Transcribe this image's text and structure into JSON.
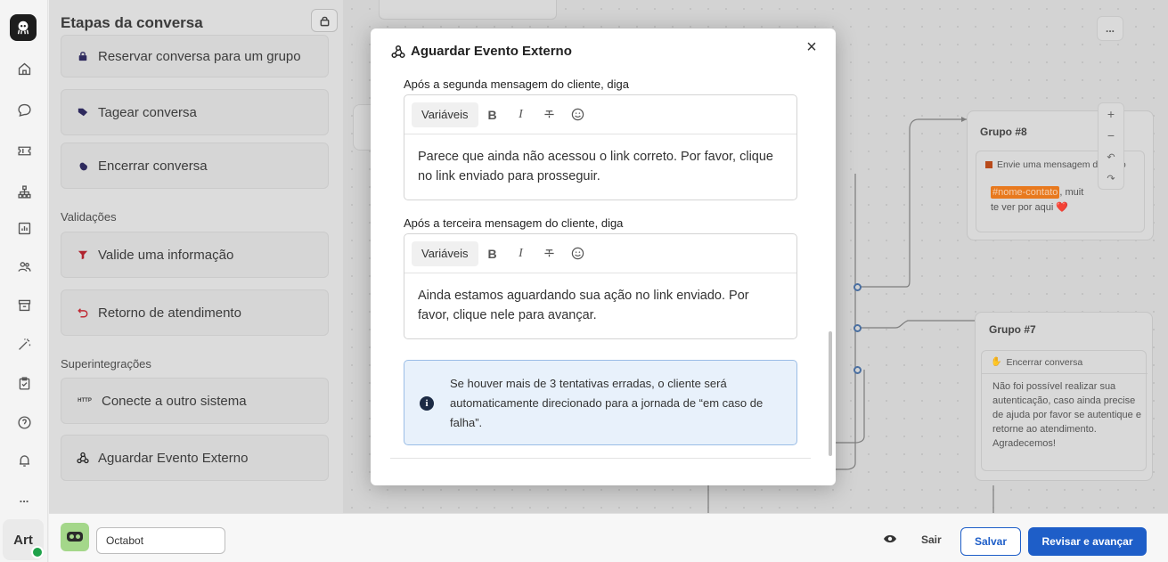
{
  "sidebar": {
    "title": "Etapas da conversa",
    "items_top": [
      {
        "label": "Reservar conversa para um grupo",
        "icon": "lock-icon"
      },
      {
        "label": "Tagear conversa",
        "icon": "tag-icon"
      },
      {
        "label": "Encerrar conversa",
        "icon": "wave-hand-icon"
      }
    ],
    "section_validacoes": "Validações",
    "items_validacoes": [
      {
        "label": "Valide uma informação",
        "icon": "filter-icon"
      },
      {
        "label": "Retorno de atendimento",
        "icon": "return-icon"
      }
    ],
    "section_super": "Superintegrações",
    "items_super": [
      {
        "label": "Conecte a outro sistema",
        "icon": "http-icon"
      },
      {
        "label": "Aguardar Evento Externo",
        "icon": "webhook-icon"
      }
    ]
  },
  "rail": {
    "user_initials": "Art",
    "more": "..."
  },
  "modal": {
    "title": "Aguardar Evento Externo",
    "section1_label": "Após a segunda mensagem do cliente, diga",
    "section1_text": "Parece que ainda não acessou o link correto. Por favor, clique no link enviado para prosseguir.",
    "section2_label": "Após a terceira mensagem do cliente, diga",
    "section2_text": "Ainda estamos aguardando sua ação no link enviado. Por favor, clique nele para avançar.",
    "variables_label": "Variáveis",
    "bold_label": "B",
    "italic_label": "I",
    "info_text": "Se houver mais de 3 tentativas erradas, o cliente será automaticamente direcionado para a jornada de “em caso de falha”."
  },
  "canvas": {
    "group8": {
      "title": "Grupo #8",
      "card_title": "Envie uma mensagem de texto",
      "tag": "#nome-contato",
      "text_after_tag": ", muit",
      "text_line2": "te ver por aqui ❤️"
    },
    "group7": {
      "title": "Grupo #7",
      "card_title": "Encerrar conversa",
      "text": "Não foi possível realizar sua autenticação, caso ainda precise de ajuda por favor se autentique e retorne ao atendimento. Agradecemos!"
    },
    "more": "..."
  },
  "bottom": {
    "bot_name": "Octabot",
    "exit_label": "Sair",
    "save_label": "Salvar",
    "review_label": "Revisar e avançar"
  },
  "colors": {
    "primary": "#1e5ec8",
    "info_bg": "#e8f1fb",
    "online": "#1fa24a",
    "tag": "#e8791e"
  }
}
